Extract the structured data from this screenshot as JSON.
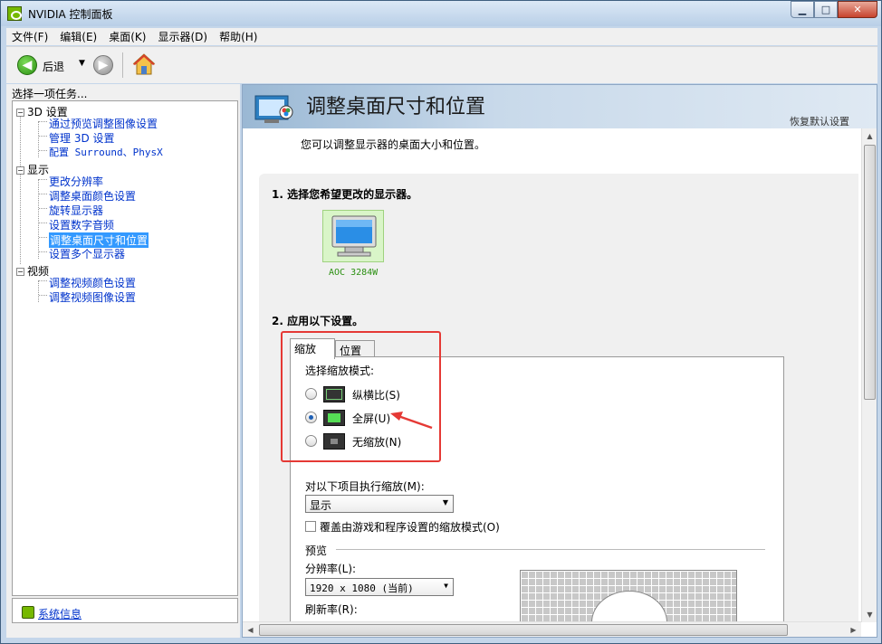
{
  "window": {
    "title": "NVIDIA 控制面板"
  },
  "menubar": {
    "items": [
      "文件(F)",
      "编辑(E)",
      "桌面(K)",
      "显示器(D)",
      "帮助(H)"
    ]
  },
  "toolbar": {
    "back_label": "后退"
  },
  "left": {
    "header": "选择一项任务...",
    "tree": [
      {
        "label": "3D 设置",
        "type": "category"
      },
      {
        "label": "通过预览调整图像设置",
        "type": "link"
      },
      {
        "label": "管理 3D 设置",
        "type": "link"
      },
      {
        "label": "配置 Surround、PhysX",
        "type": "link"
      },
      {
        "label": "显示",
        "type": "category"
      },
      {
        "label": "更改分辨率",
        "type": "link"
      },
      {
        "label": "调整桌面颜色设置",
        "type": "link"
      },
      {
        "label": "旋转显示器",
        "type": "link"
      },
      {
        "label": "设置数字音频",
        "type": "link"
      },
      {
        "label": "调整桌面尺寸和位置",
        "type": "selected"
      },
      {
        "label": "设置多个显示器",
        "type": "link"
      },
      {
        "label": "视频",
        "type": "category"
      },
      {
        "label": "调整视频颜色设置",
        "type": "link"
      },
      {
        "label": "调整视频图像设置",
        "type": "link"
      }
    ],
    "system_info": "系统信息"
  },
  "main": {
    "title": "调整桌面尺寸和位置",
    "restore_defaults": "恢复默认设置",
    "description": "您可以调整显示器的桌面大小和位置。",
    "step1": "1. 选择您希望更改的显示器。",
    "monitor_name": "AOC 3284W",
    "step2": "2. 应用以下设置。",
    "tabs": [
      "缩放",
      "位置"
    ],
    "scaling_mode_label": "选择缩放模式:",
    "scaling_options": [
      {
        "label": "纵横比(S)",
        "selected": false
      },
      {
        "label": "全屏(U)",
        "selected": true
      },
      {
        "label": "无缩放(N)",
        "selected": false
      }
    ],
    "perform_scaling_label": "对以下项目执行缩放(M):",
    "perform_scaling_value": "显示",
    "override_label": "覆盖由游戏和程序设置的缩放模式(O)",
    "preview_label": "预览",
    "resolution_label": "分辨率(L):",
    "resolution_value": "1920 x 1080 (当前)",
    "refresh_label": "刷新率(R):"
  },
  "colors": {
    "accent_green": "#76b900",
    "highlight": "#e53935",
    "selection": "#3399ff"
  }
}
